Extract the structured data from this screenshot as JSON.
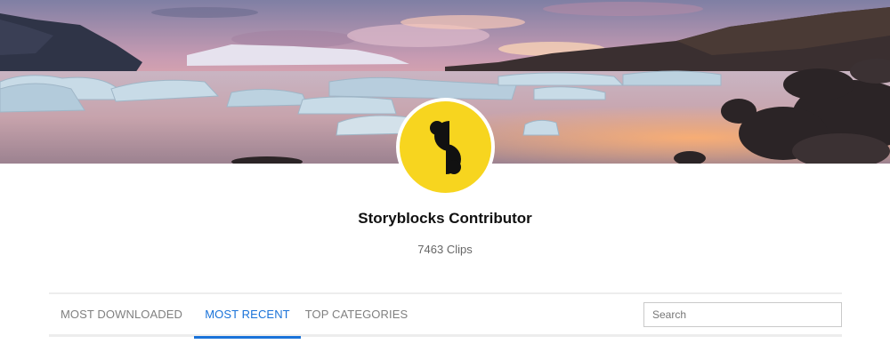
{
  "profile": {
    "name": "Storyblocks Contributor",
    "clip_count": "7463 Clips",
    "logo_icon": "storyblocks-s-logo-icon",
    "logo_color": "#f7d51f"
  },
  "tabs": [
    {
      "label": "MOST DOWNLOADED",
      "active": false
    },
    {
      "label": "MOST RECENT",
      "active": true
    },
    {
      "label": "TOP CATEGORIES",
      "active": false
    }
  ],
  "search": {
    "placeholder": "Search",
    "value": ""
  },
  "colors": {
    "accent": "#1a73d9",
    "tab_inactive": "#808080"
  }
}
